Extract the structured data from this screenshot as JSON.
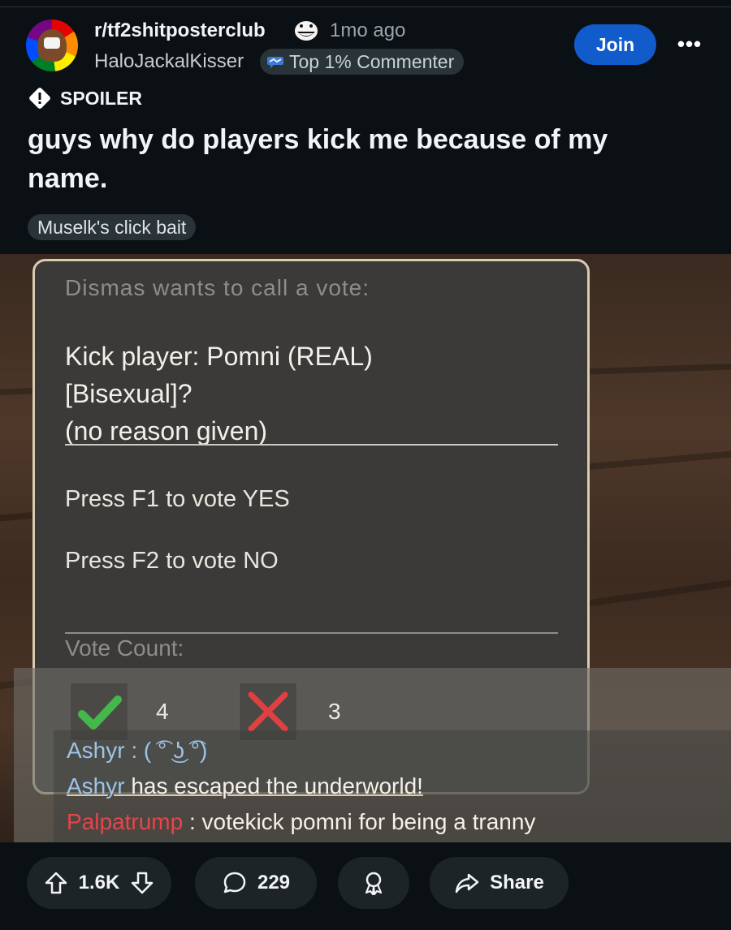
{
  "header": {
    "subreddit": "r/tf2shitposterclub",
    "age": "1mo ago",
    "username": "HaloJackalKisser",
    "user_flair": "Top 1% Commenter",
    "join_label": "Join",
    "more_label": "•••"
  },
  "post": {
    "spoiler_label": "SPOILER",
    "title": "guys why do players kick me because of my name.",
    "flair": "Muselk's click bait"
  },
  "image": {
    "vote_title": "Dismas wants to call a vote:",
    "kick_line1": "Kick player: Pomni (REAL)",
    "kick_line2": "[Bisexual]?",
    "kick_line3": "(no reason given)",
    "press_yes": "Press F1 to vote YES",
    "press_no": "Press F2 to vote NO",
    "vote_count_label": "Vote Count:",
    "yes_count": "4",
    "no_count": "3",
    "chat": [
      {
        "name": "Ashyr",
        "sep": " :  ",
        "text": "( ͡° ͜ʖ ͡°)"
      },
      {
        "name": "Ashyr",
        "sep": " ",
        "text": "has escaped the underworld!"
      },
      {
        "name": "Palpatrump",
        "sep": " :  ",
        "text": "votekick pomni for being a tranny"
      }
    ]
  },
  "footer": {
    "votes": "1.6K",
    "comments": "229",
    "share_label": "Share"
  },
  "colors": {
    "join_button": "#115bca",
    "background": "#0b1014",
    "chat_blue": "#9dc3ea",
    "chat_red": "#e8444a"
  }
}
